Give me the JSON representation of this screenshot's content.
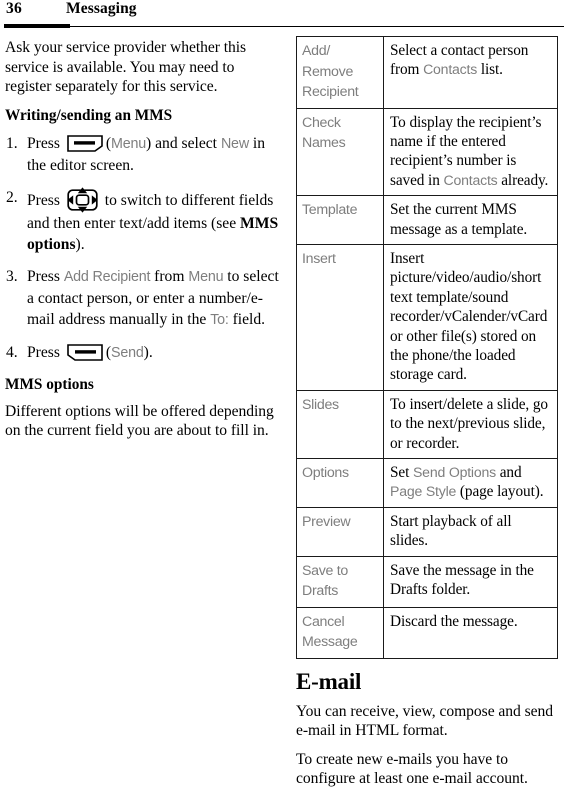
{
  "header": {
    "page_number": "36",
    "title": "Messaging"
  },
  "left_column": {
    "intro": "Ask your service provider whether this service is available. You may need to register separately for this service.",
    "subheading": "Writing/sending an MMS",
    "steps": [
      {
        "num": "1.",
        "pre": "Press",
        "icon": "softkey-menu-icon",
        "mid_paren_open": "(",
        "ui_1": "Menu",
        "mid": ") and select",
        "ui_2": "New",
        "post": "in the editor screen."
      },
      {
        "num": "2.",
        "pre": "Press",
        "icon": "navigation-key-icon",
        "post_a": "to switch to different fields and then enter text/add items (see",
        "bold": "MMS options",
        "post_b": ")."
      },
      {
        "num": "3.",
        "pre": "Press",
        "ui_1": "Add Recipient",
        "mid": "from",
        "ui_2": "Menu",
        "post_a": "to select a contact person, or enter a number/e-mail address manually in the",
        "ui_3": "To:",
        "post_b": "field."
      },
      {
        "num": "4.",
        "pre": "Press",
        "icon": "softkey-send-icon",
        "mid_paren_open": "(",
        "ui_1": "Send",
        "post": ")."
      }
    ],
    "mms_options_heading": "MMS options",
    "mms_options_body": "Different options will be offered depending on the current field you are about to fill in."
  },
  "table": {
    "rows": [
      {
        "key": "Add/ Remove Recipient",
        "value_parts": [
          {
            "t": "Select a contact person from ",
            "style": "serif"
          },
          {
            "t": "Contacts",
            "style": "ui"
          },
          {
            "t": " list.",
            "style": "serif"
          }
        ]
      },
      {
        "key": "Check Names",
        "value_parts": [
          {
            "t": "To display the recipient’s name if the entered recipient’s number is saved in ",
            "style": "serif"
          },
          {
            "t": "Contacts",
            "style": "ui"
          },
          {
            "t": " already.",
            "style": "serif"
          }
        ]
      },
      {
        "key": "Template",
        "value_parts": [
          {
            "t": "Set the current MMS message as a template.",
            "style": "serif"
          }
        ]
      },
      {
        "key": "Insert",
        "value_parts": [
          {
            "t": "Insert picture/video/audio/short text template/sound recorder/vCalender/vCard or other file(s) stored on the phone/the loaded storage card.",
            "style": "serif"
          }
        ]
      },
      {
        "key": "Slides",
        "value_parts": [
          {
            "t": "To insert/delete a slide, go to the next/previous slide, or recorder.",
            "style": "serif"
          }
        ]
      },
      {
        "key": "Options",
        "value_parts": [
          {
            "t": "Set ",
            "style": "serif"
          },
          {
            "t": "Send Options",
            "style": "ui"
          },
          {
            "t": " and ",
            "style": "serif"
          },
          {
            "t": "Page Style",
            "style": "ui"
          },
          {
            "t": " (page layout).",
            "style": "serif"
          }
        ]
      },
      {
        "key": "Preview",
        "value_parts": [
          {
            "t": "Start playback of all slides.",
            "style": "serif"
          }
        ]
      },
      {
        "key": "Save to Drafts",
        "value_parts": [
          {
            "t": "Save the message in the Drafts folder.",
            "style": "serif"
          }
        ]
      },
      {
        "key": "Cancel Message",
        "value_parts": [
          {
            "t": "Discard the message.",
            "style": "serif"
          }
        ]
      }
    ]
  },
  "email_section": {
    "heading": "E-mail",
    "para_1": "You can receive, view, compose and send e-mail in HTML format.",
    "para_2": "To create new e-mails you have to configure at least one e-mail account."
  },
  "colors": {
    "ui_gray": "#7e7e7e",
    "text": "#000000",
    "rule": "#000000",
    "table_border": "#1a1a1a"
  }
}
